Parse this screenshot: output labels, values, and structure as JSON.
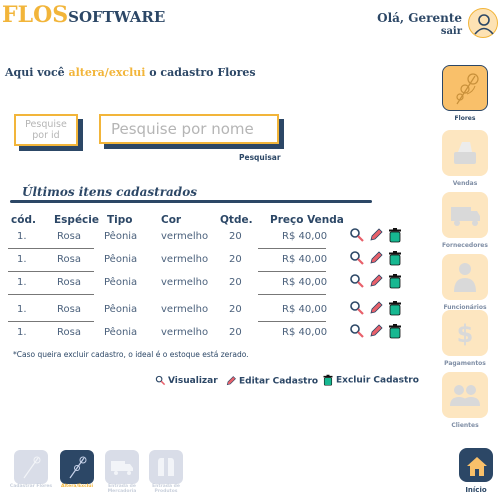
{
  "header": {
    "logo_main": "FLOS",
    "logo_sub": "SOFTWARE",
    "greeting": "Olá, Gerente",
    "logout": "sair"
  },
  "page": {
    "subtitle_pre": "Aqui você ",
    "subtitle_highlight": "altera/exclui",
    "subtitle_post": " o cadastro Flores",
    "search_id_placeholder": "Pesquise por id",
    "search_name_placeholder": "Pesquise por nome",
    "search_button": "Pesquisar",
    "section_title": "Últimos itens cadastrados",
    "note": "*Caso queira excluir cadastro, o ideal é o estoque está zerado."
  },
  "table": {
    "headers": [
      "cód.",
      "Espécie",
      "Tipo",
      "Cor",
      "Qtde.",
      "Preço Venda"
    ],
    "rows": [
      [
        "1.",
        "Rosa",
        "Pêonia",
        "vermelho",
        "20",
        "R$ 40,00"
      ],
      [
        "1.",
        "Rosa",
        "Pêonia",
        "vermelho",
        "20",
        "R$ 40,00"
      ],
      [
        "1.",
        "Rosa",
        "Pêonia",
        "vermelho",
        "20",
        "R$ 40,00"
      ],
      [
        "1.",
        "Rosa",
        "Pêonia",
        "vermelho",
        "20",
        "R$ 40,00"
      ],
      [
        "1.",
        "Rosa",
        "Pêonia",
        "vermelho",
        "20",
        "R$ 40,00"
      ]
    ]
  },
  "legend": {
    "view": "Visualizar",
    "edit": "Editar Cadastro",
    "delete": "Excluir Cadastro"
  },
  "sidebar": {
    "items": [
      {
        "label": "Flores",
        "icon": "flower-icon",
        "active": true
      },
      {
        "label": "Vendas",
        "icon": "sales-icon",
        "active": false
      },
      {
        "label": "Fornecedores",
        "icon": "truck-icon",
        "active": false
      },
      {
        "label": "Funcionários",
        "icon": "employee-icon",
        "active": false
      },
      {
        "label": "Pagamentos",
        "icon": "dollar-icon",
        "active": false
      },
      {
        "label": "Clientes",
        "icon": "clients-icon",
        "active": false
      }
    ],
    "home": "Início"
  },
  "bottom_nav": {
    "items": [
      {
        "label": "Cadastrar Flores",
        "icon": "flower-icon",
        "selected": false
      },
      {
        "label": "Altera/Exclui",
        "icon": "flower-icon",
        "selected": true
      },
      {
        "label": "Entrada de Mercadoria",
        "icon": "truck-icon",
        "selected": false
      },
      {
        "label": "Entrada de Produtos",
        "icon": "gloves-icon",
        "selected": false
      }
    ]
  },
  "colors": {
    "accent": "#f2b53a",
    "primary": "#2c4766",
    "panel": "#fde6c0",
    "delete_icon": "#17b891",
    "edit_icon": "#e8606a"
  }
}
